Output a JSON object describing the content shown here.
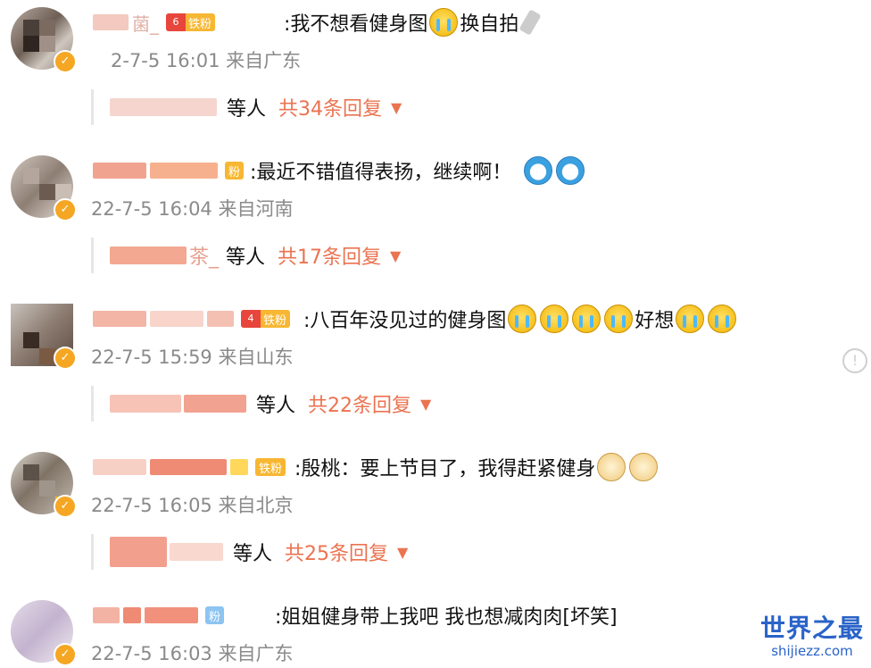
{
  "comments": [
    {
      "name_visible": "菌_",
      "content": ":我不想看健身图",
      "content_tail": "换自拍",
      "fan_label": "铁粉",
      "fan_level": "6",
      "time": "2-7-5 16:01 来自广东",
      "reply_user_visible": "",
      "reply_others": "等人",
      "reply_count": "共34条回复",
      "emojis": [
        "cry-emoji"
      ]
    },
    {
      "name_visible": "",
      "content": ":最近不错值得表扬，继续啊！",
      "fan_label": "粉",
      "time": "22-7-5 16:04 来自河南",
      "reply_user_visible": "茶_",
      "reply_others": "等人",
      "reply_count": "共17条回复",
      "emojis": [
        "doraemon-emoji",
        "doraemon-emoji"
      ]
    },
    {
      "name_visible": "",
      "content": ":八百年没见过的健身图",
      "content_tail": "好想",
      "fan_label": "铁粉",
      "fan_level": "4",
      "time": "22-7-5 15:59 来自山东",
      "reply_user_visible": "",
      "reply_others": "等人",
      "reply_count": "共22条回复",
      "emojis": [
        "cry-emoji"
      ]
    },
    {
      "name_visible": "",
      "content": ":殷桃：要上节目了，我得赶紧健身",
      "fan_label": "铁粉",
      "time": "22-7-5 16:05 来自北京",
      "reply_user_visible": "",
      "reply_others": "等人",
      "reply_count": "共25条回复",
      "emojis": [
        "doge-emoji",
        "doge-emoji"
      ]
    },
    {
      "name_visible": "",
      "content": ":姐姐健身带上我吧 我也想减肉肉[坏笑]",
      "fan_label": "粉",
      "time": "22-7-5 16:03 来自广东"
    }
  ],
  "chevron": "▼",
  "report_icon": "!",
  "verified_icon": "✓",
  "watermark": {
    "title": "世界之最",
    "url": "shijiezz.com"
  },
  "colors": {
    "accent": "#eb7350",
    "meta": "#8a8a8a",
    "fan_badge": "#f7b733",
    "watermark": "#2a63c8"
  }
}
